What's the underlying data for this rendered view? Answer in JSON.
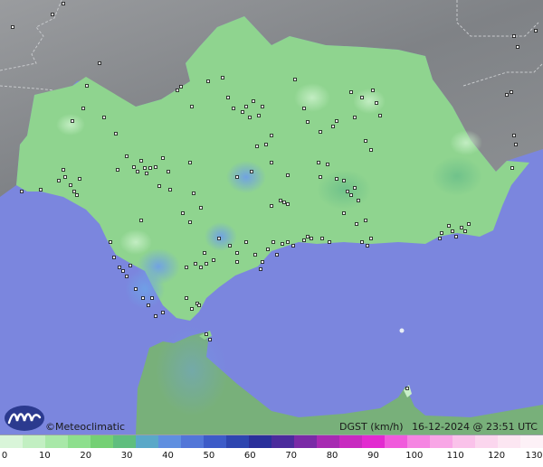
{
  "credit": "Meteoclimatic",
  "credit_symbol": "©",
  "variable_label": "DGST (km/h)",
  "timestamp": "16-12-2024 @ 23:51 UTC",
  "scale": {
    "ticks": [
      "0",
      "10",
      "20",
      "30",
      "40",
      "50",
      "60",
      "70",
      "80",
      "90",
      "100",
      "110",
      "120",
      "130"
    ],
    "colors": [
      "#d9f5d9",
      "#c2efc2",
      "#a8e8a8",
      "#8ddf8d",
      "#74d074",
      "#5fbe7e",
      "#5aa8c8",
      "#5f8fe0",
      "#5276d8",
      "#3d5bc8",
      "#2e45b0",
      "#2a2f9a",
      "#4b2b9c",
      "#7a2aa6",
      "#a72ab2",
      "#c82ac0",
      "#e22ad0",
      "#f05adc",
      "#f585e2",
      "#f8a6e6",
      "#fac2ea",
      "#fbd6ee",
      "#fce6f2",
      "#fdf1f7"
    ]
  },
  "colors": {
    "sea": "#7b86de",
    "land_outside": "#8f9295",
    "andalucia": "#8fd48f",
    "morocco": "#78b07a"
  },
  "station_icon": "station-marker-icon",
  "logo_icon": "meteoclimatic-logo-icon"
}
